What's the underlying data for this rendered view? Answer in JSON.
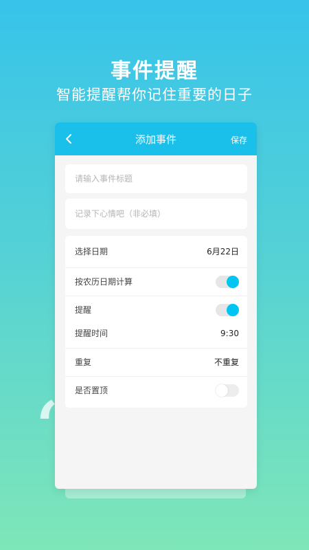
{
  "hero": {
    "title": "事件提醒",
    "subtitle": "智能提醒帮你记住重要的日子"
  },
  "decor": {
    "quote_mark": "“"
  },
  "nav": {
    "back_icon": "chevron-left-icon",
    "title": "添加事件",
    "save_label": "保存"
  },
  "form": {
    "title_placeholder": "请输入事件标题",
    "mood_placeholder": "记录下心情吧（非必填）"
  },
  "settings": {
    "date_label": "选择日期",
    "date_value": "6月22日",
    "lunar_label": "按农历日期计算",
    "lunar_on": true,
    "remind_label": "提醒",
    "remind_on": true,
    "remind_time_label": "提醒时间",
    "remind_time_value": "9:30",
    "repeat_label": "重复",
    "repeat_value": "不重复",
    "pin_label": "是否置顶",
    "pin_on": false
  },
  "colors": {
    "nav": "#1ABFEA",
    "toggle_on": "#00C5F1",
    "bg_top": "#37C3EA",
    "bg_bottom": "#7EE6B8"
  }
}
